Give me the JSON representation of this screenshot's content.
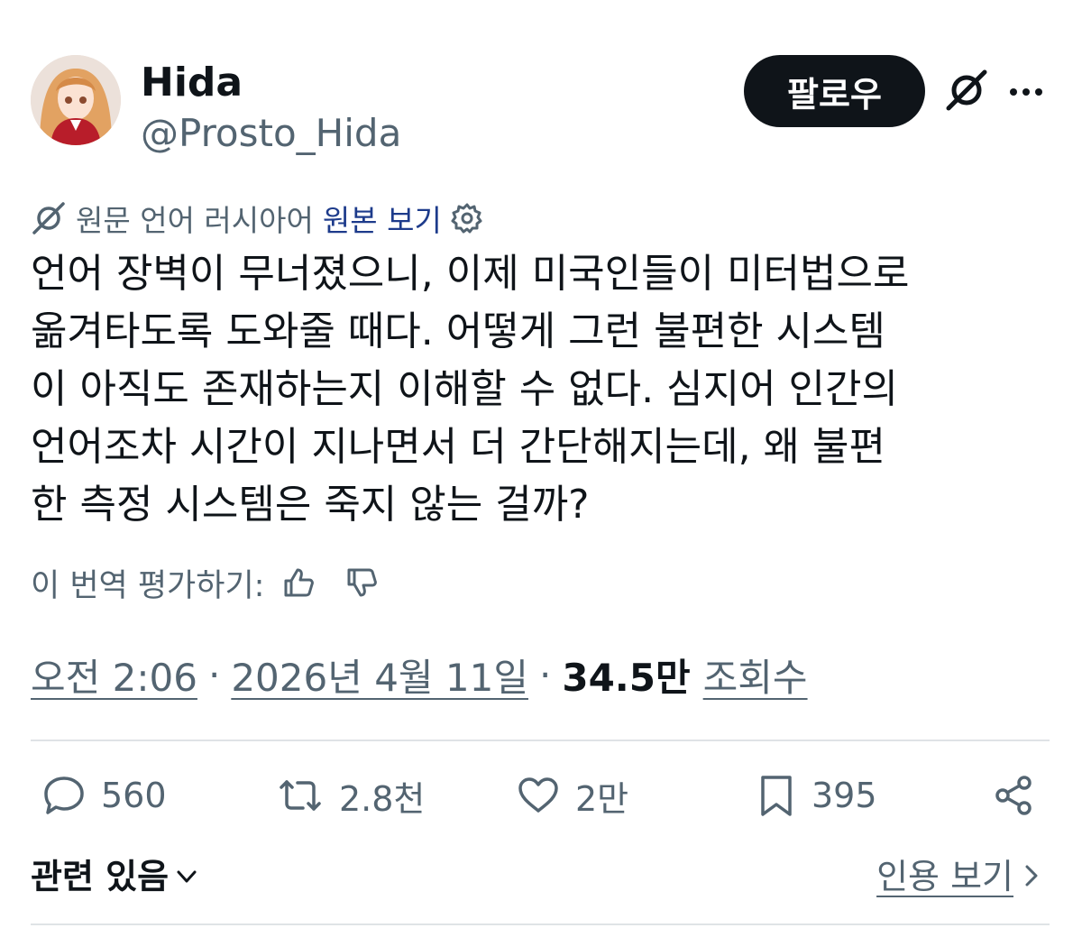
{
  "author": {
    "display_name": "Hida",
    "handle": "@Prosto_Hida"
  },
  "follow_label": "팔로우",
  "translation": {
    "label": "원문 언어 러시아어",
    "show_original_label": "원본 보기"
  },
  "tweet": {
    "text": "언어 장벽이 무너졌으니, 이제 미국인들이 미터법으로\n옮겨타도록 도와줄 때다. 어떻게 그런 불편한 시스템\n이 아직도 존재하는지 이해할 수 없다. 심지어 인간의\n언어조차 시간이 지나면서 더 간단해지는데, 왜 불편\n한 측정 시스템은 죽지 않는 걸까?"
  },
  "rate_translation_label": "이 번역 평가하기:",
  "meta": {
    "time": "오전 2:06",
    "date": "2026년 4월 11일",
    "separator": "·",
    "views_count": "34.5만",
    "views_label": "조회수"
  },
  "actions": {
    "replies": "560",
    "reposts": "2.8천",
    "likes": "2만",
    "bookmarks": "395"
  },
  "related_label": "관련 있음",
  "quote_label": "인용 보기",
  "icons": [
    "grok-icon",
    "more-icon",
    "settings-gear-icon",
    "thumbs-up-icon",
    "thumbs-down-icon",
    "reply-icon",
    "repost-icon",
    "like-heart-icon",
    "bookmark-icon",
    "share-icon",
    "chevron-down-icon",
    "chevron-right-icon"
  ],
  "colors": {
    "text": "#0f1419",
    "secondary": "#536471",
    "link": "#1d3b8b",
    "button_bg": "#0f1419"
  }
}
